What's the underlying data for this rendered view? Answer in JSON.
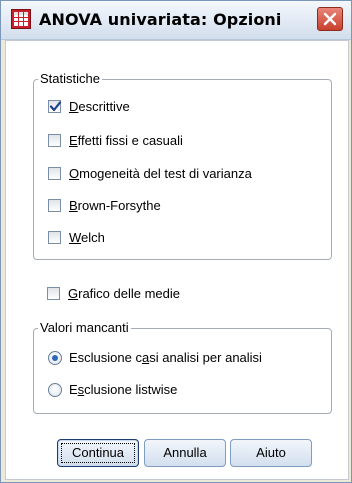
{
  "window": {
    "title": "ANOVA univariata: Opzioni",
    "title_icon": "spss-dialog-grid-icon",
    "close_icon": "close-icon",
    "colors": {
      "close": "#c9402d",
      "accent": "#2f68b7",
      "titlebar": "#dfe8f3"
    }
  },
  "statistiche": {
    "legend": "Statistiche",
    "options": [
      {
        "pre": "",
        "key": "D",
        "post": "escrittive",
        "checked": true
      },
      {
        "pre": "",
        "key": "E",
        "post": "ffetti fissi e casuali",
        "checked": false
      },
      {
        "pre": "",
        "key": "O",
        "post": "mogeneità del test di varianza",
        "checked": false
      },
      {
        "pre": "",
        "key": "B",
        "post": "rown-Forsythe",
        "checked": false
      },
      {
        "pre": "",
        "key": "W",
        "post": "elch",
        "checked": false
      }
    ]
  },
  "grafico": {
    "pre": "",
    "key": "G",
    "post": "rafico delle medie",
    "checked": false
  },
  "valori_mancanti": {
    "legend": "Valori mancanti",
    "options": [
      {
        "pre": "Esclusione c",
        "key": "a",
        "post": "si analisi per analisi",
        "selected": true
      },
      {
        "pre": "E",
        "key": "s",
        "post": "clusione listwise",
        "selected": false
      }
    ]
  },
  "buttons": {
    "continua": "Continua",
    "annulla": "Annulla",
    "aiuto": "Aiuto"
  }
}
